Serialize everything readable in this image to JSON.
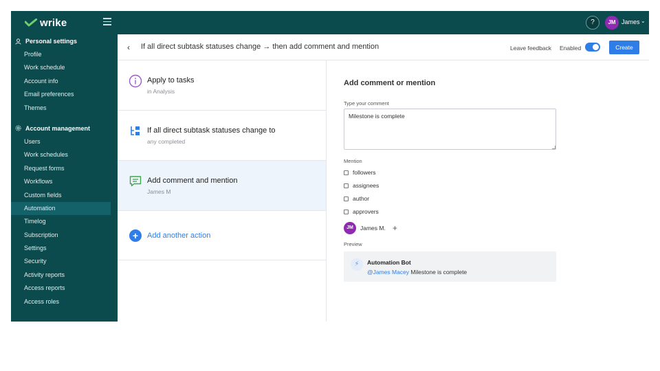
{
  "topbar": {
    "logo_text": "wrike",
    "help_label": "?",
    "avatar_initials": "JM",
    "user_name": "James",
    "user_chevron": "⌄"
  },
  "sidebar": {
    "personal_title": "Personal settings",
    "personal_items": [
      "Profile",
      "Work schedule",
      "Account info",
      "Email preferences",
      "Themes"
    ],
    "account_title": "Account management",
    "account_items": [
      "Users",
      "Work schedules",
      "Request forms",
      "Workflows",
      "Custom fields",
      "Automation",
      "Timelog",
      "Subscription",
      "Settings",
      "Security",
      "Activity reports",
      "Access reports",
      "Access roles"
    ],
    "active_item": "Automation"
  },
  "header": {
    "back": "‹",
    "title": "If all direct subtask statuses change → then add comment and mention",
    "feedback": "Leave feedback",
    "enabled_label": "Enabled",
    "create": "Create"
  },
  "steps": [
    {
      "title": "Apply to tasks",
      "subtitle": "in Analysis",
      "icon": "info-icon"
    },
    {
      "title": "If all direct subtask statuses change to",
      "subtitle": "any completed",
      "icon": "subtask-icon"
    },
    {
      "title": "Add comment and mention",
      "subtitle": "James M",
      "icon": "comment-icon"
    }
  ],
  "add_action": {
    "plus": "+",
    "label": "Add another action"
  },
  "panel": {
    "heading": "Add comment or mention",
    "comment_label": "Type your comment",
    "comment_value": "Milestone is complete",
    "mention_label": "Mention",
    "mention_options": [
      "followers",
      "assignees",
      "author",
      "approvers"
    ],
    "mention_user_initials": "JM",
    "mention_user_name": "James M.",
    "mention_add": "+",
    "preview_label": "Preview",
    "preview_bot_icon": "⚡",
    "preview_bot_name": "Automation Bot",
    "preview_mention": "@James Macey",
    "preview_text": " Milestone is complete"
  },
  "colors": {
    "sidebar_bg": "#0b4a4d",
    "accent": "#2f7ee8",
    "avatar": "#8e2bb0"
  }
}
